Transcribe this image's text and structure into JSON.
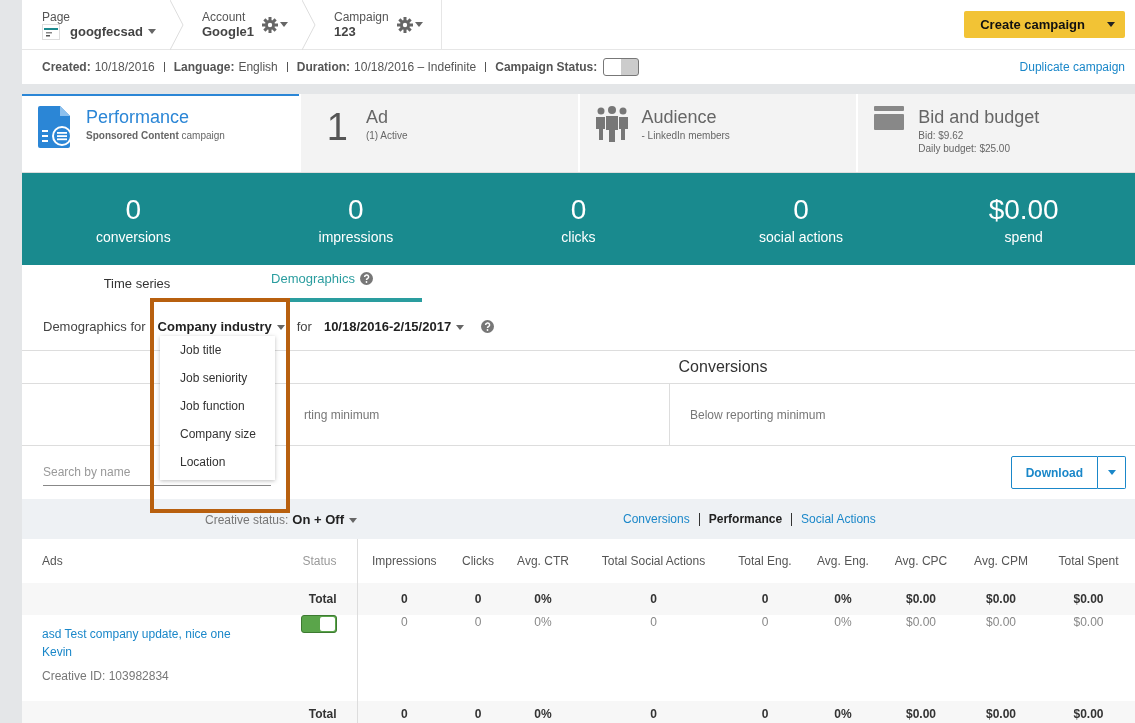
{
  "breadcrumbs": [
    {
      "kind": "page",
      "label": "Page",
      "value": "googfecsad"
    },
    {
      "kind": "account",
      "label": "Account",
      "value": "Google1"
    },
    {
      "kind": "campaign",
      "label": "Campaign",
      "value": "123"
    }
  ],
  "create_button": "Create campaign",
  "info": [
    {
      "label": "Created:",
      "value": "10/18/2016"
    },
    {
      "label": "Language:",
      "value": "English"
    },
    {
      "label": "Duration:",
      "value": "10/18/2016 – Indefinite"
    }
  ],
  "campaign_status": {
    "label": "Campaign Status:",
    "on": false
  },
  "duplicate_link": "Duplicate campaign",
  "cards": [
    {
      "kind": "performance",
      "title": "Performance",
      "lines": [
        "**Sponsored Content** campaign"
      ],
      "selected": true
    },
    {
      "kind": "ad",
      "number": "1",
      "title": "Ad",
      "lines": [
        "(1) Active"
      ],
      "selected": false
    },
    {
      "kind": "audience",
      "title": "Audience",
      "lines": [
        "- LinkedIn members"
      ],
      "selected": false
    },
    {
      "kind": "budget",
      "title": "Bid and budget",
      "lines": [
        "Bid:  $9.62",
        "Daily budget:  $25.00"
      ],
      "selected": false
    }
  ],
  "metrics": [
    {
      "value": "0",
      "label": "conversions"
    },
    {
      "value": "0",
      "label": "impressions"
    },
    {
      "value": "0",
      "label": "clicks"
    },
    {
      "value": "0",
      "label": "social actions"
    },
    {
      "value": "$0.00",
      "label": "spend"
    }
  ],
  "subtabs": [
    {
      "label": "Time series",
      "selected": false,
      "help": false
    },
    {
      "label": "Demographics",
      "selected": true,
      "help": true
    }
  ],
  "demographics_filter": {
    "prefix": "Demographics for",
    "facet": "Company industry",
    "joiner": "for",
    "range": "10/18/2016-2/15/2017"
  },
  "facet_menu": [
    "Job title",
    "Job seniority",
    "Job function",
    "Company size",
    "Location"
  ],
  "breakdown": {
    "header": "Conversions",
    "cells": [
      "rting minimum",
      "Below reporting minimum"
    ]
  },
  "search": {
    "placeholder": "Search by name"
  },
  "download_button": "Download",
  "creative_status": {
    "label": "Creative status:",
    "value": "On + Off"
  },
  "views": [
    {
      "label": "Conversions",
      "selected": false
    },
    {
      "label": "Performance",
      "selected": true
    },
    {
      "label": "Social Actions",
      "selected": false
    }
  ],
  "table": {
    "columns": [
      "Ads",
      "Status",
      "Impressions",
      "Clicks",
      "Avg. CTR",
      "Total Social Actions",
      "Total Eng.",
      "Avg. Eng.",
      "Avg. CPC",
      "Avg. CPM",
      "Total Spent"
    ],
    "rows": [
      {
        "kind": "total",
        "cells": [
          "",
          "Total",
          "0",
          "0",
          "0%",
          "0",
          "0",
          "0%",
          "$0.00",
          "$0.00",
          "$0.00"
        ]
      },
      {
        "kind": "ad",
        "cells": [
          {
            "title": "asd Test company update, nice one Kevin",
            "creative_id": "Creative ID: 103982834"
          },
          {
            "on": true
          },
          "0",
          "0",
          "0%",
          "0",
          "0",
          "0%",
          "$0.00",
          "$0.00",
          "$0.00"
        ]
      },
      {
        "kind": "total",
        "cells": [
          "",
          "Total",
          "0",
          "0",
          "0%",
          "0",
          "0",
          "0%",
          "$0.00",
          "$0.00",
          "$0.00"
        ]
      }
    ]
  },
  "highlight_box": true
}
